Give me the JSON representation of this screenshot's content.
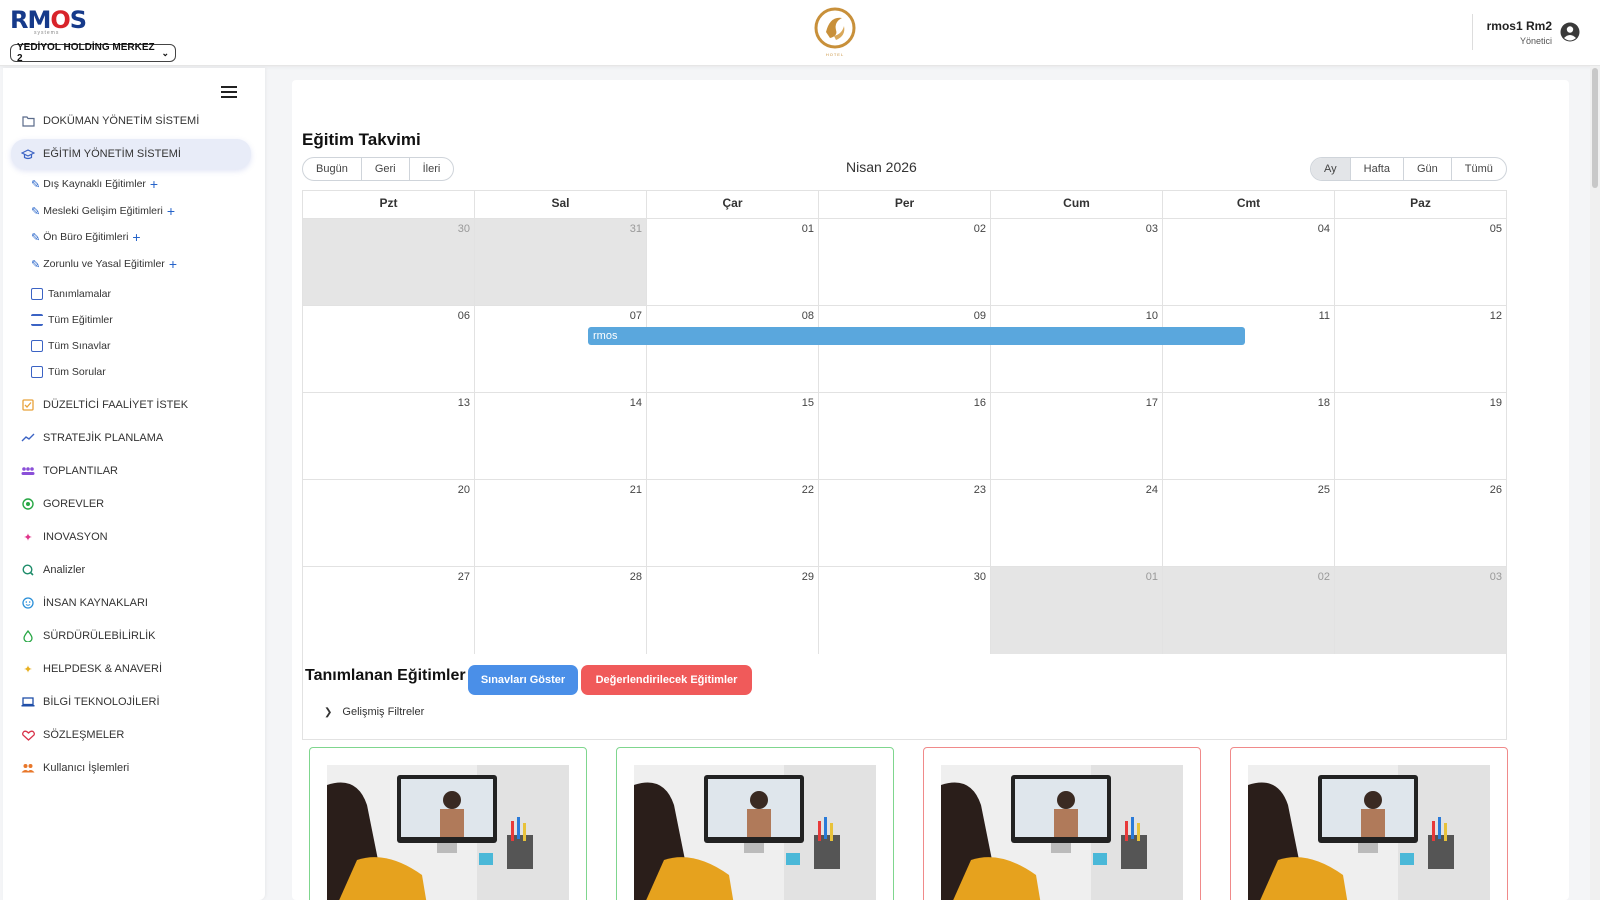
{
  "header": {
    "brand": "RMOS",
    "brand_sub": "systems",
    "company_select": "YEDİYOL HOLDİNG MERKEZ 2",
    "hotel_logo": "HOTEL",
    "user_name": "rmos1 Rm2",
    "user_role": "Yönetici"
  },
  "sidebar": {
    "items": [
      {
        "label": "DOKÜMAN YÖNETİM SİSTEMİ",
        "icon": "folder-icon",
        "color": "#5a6b8a"
      },
      {
        "label": "EĞİTİM YÖNETİM SİSTEMİ",
        "icon": "graduation-cap-icon",
        "color": "#3b63c4"
      },
      {
        "label": "DÜZELTİCİ FAALİYET İSTEK",
        "icon": "checklist-icon",
        "color": "#e8a23a"
      },
      {
        "label": "STRATEJİK PLANLAMA",
        "icon": "trend-icon",
        "color": "#3b63c4"
      },
      {
        "label": "TOPLANTILAR",
        "icon": "people-icon",
        "color": "#8a4fd8"
      },
      {
        "label": "GOREVLER",
        "icon": "power-icon",
        "color": "#28a745"
      },
      {
        "label": "INOVASYON",
        "icon": "sparkle-icon",
        "color": "#e0338a"
      },
      {
        "label": "Analizler",
        "icon": "analytics-icon",
        "color": "#1e8c6a"
      },
      {
        "label": "İNSAN KAYNAKLARI",
        "icon": "face-icon",
        "color": "#2a8fd8"
      },
      {
        "label": "SÜRDÜRÜLEBİLİRLİK",
        "icon": "drop-icon",
        "color": "#28a745"
      },
      {
        "label": "HELPDESK & ANAVERİ",
        "icon": "sparkle-icon",
        "color": "#e8b020"
      },
      {
        "label": "BİLGİ TEKNOLOJİLERİ",
        "icon": "laptop-icon",
        "color": "#1f4ea8"
      },
      {
        "label": "SÖZLEŞMELER",
        "icon": "handshake-icon",
        "color": "#d8334a"
      },
      {
        "label": "Kullanıcı İşlemleri",
        "icon": "users-icon",
        "color": "#e8772a"
      }
    ],
    "sub_edit": [
      {
        "label": "Dış Kaynaklı Eğitimler"
      },
      {
        "label": "Mesleki Gelişim Eğitimleri"
      },
      {
        "label": "Ön Büro Eğitimleri"
      },
      {
        "label": "Zorunlu ve Yasal Eğitimler"
      }
    ],
    "sub_list": [
      {
        "label": "Tanımlamalar"
      },
      {
        "label": "Tüm Eğitimler"
      },
      {
        "label": "Tüm Sınavlar"
      },
      {
        "label": "Tüm Sorular"
      }
    ]
  },
  "calendar": {
    "title": "Eğitim Takvimi",
    "nav": [
      "Bugün",
      "Geri",
      "İleri"
    ],
    "month_label": "Nisan 2026",
    "views": [
      "Ay",
      "Hafta",
      "Gün",
      "Tümü"
    ],
    "selected_view": "Ay",
    "weekdays": [
      "Pzt",
      "Sal",
      "Çar",
      "Per",
      "Cum",
      "Cmt",
      "Paz"
    ],
    "weeks": [
      [
        "30",
        "31",
        "01",
        "02",
        "03",
        "04",
        "05"
      ],
      [
        "06",
        "07",
        "08",
        "09",
        "10",
        "11",
        "12"
      ],
      [
        "13",
        "14",
        "15",
        "16",
        "17",
        "18",
        "19"
      ],
      [
        "20",
        "21",
        "22",
        "23",
        "24",
        "25",
        "26"
      ],
      [
        "27",
        "28",
        "29",
        "30",
        "01",
        "02",
        "03"
      ]
    ],
    "event": {
      "label": "rmos",
      "color": "#5aa7dd"
    }
  },
  "trainings": {
    "title": "Tanımlanan Eğitimler",
    "show_exams": "Sınavları Göster",
    "to_evaluate": "Değerlendirilecek Eğitimler",
    "advanced_filters": "Gelişmiş Filtreler",
    "card_status_colors": [
      "#7fd68e",
      "#7fd68e",
      "#f08a8a",
      "#f08a8a"
    ]
  }
}
